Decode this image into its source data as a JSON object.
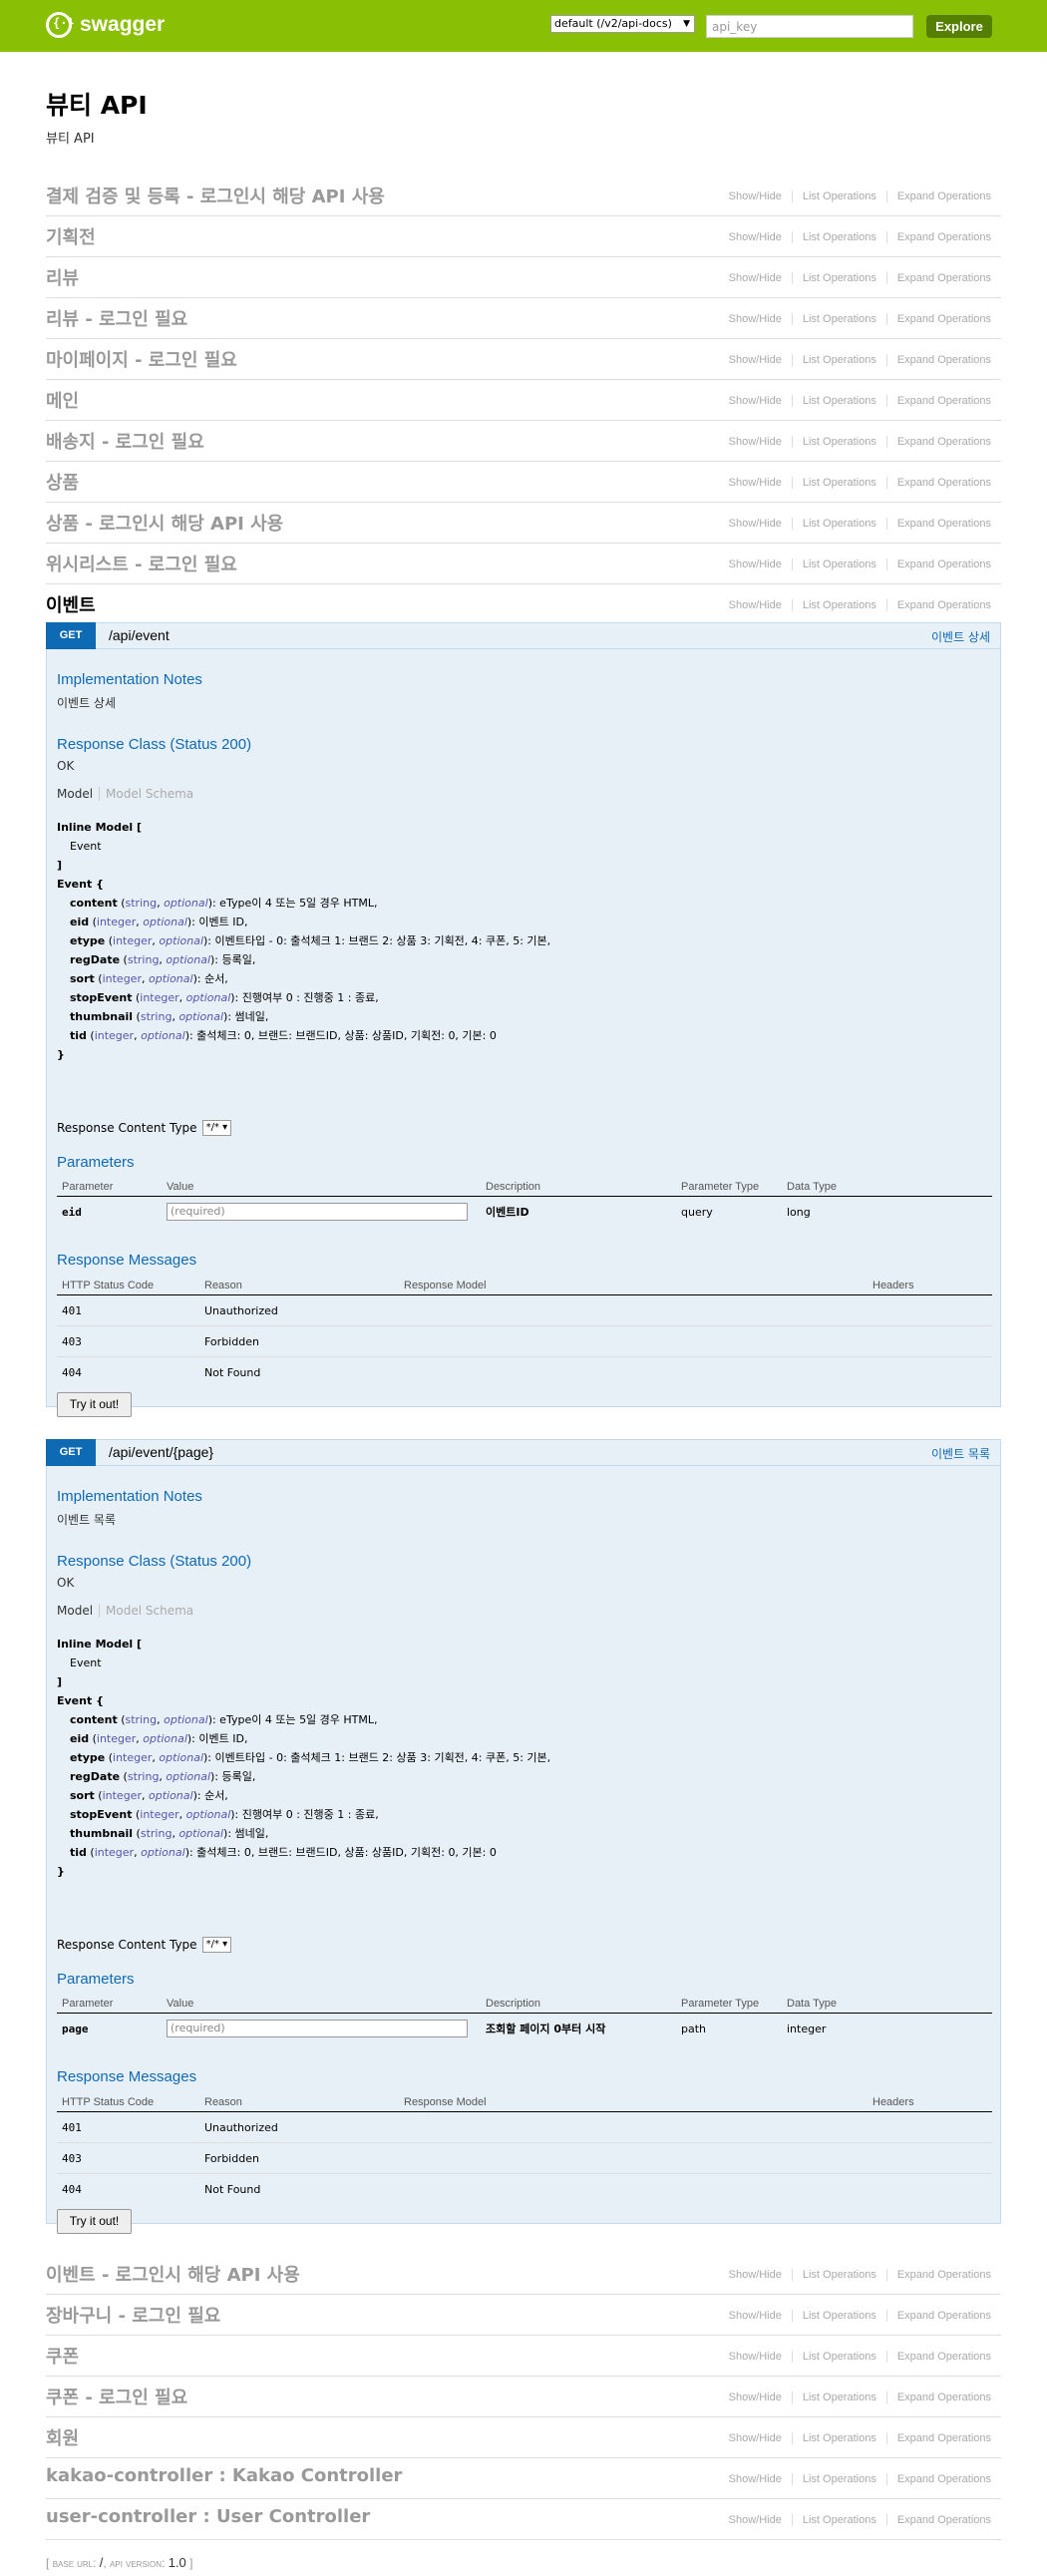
{
  "header": {
    "logo_text": "swagger",
    "logo_icon": "swagger-braces-icon",
    "spec_select": "default (/v2/api-docs)",
    "api_key_placeholder": "api_key",
    "explore_label": "Explore"
  },
  "info": {
    "title": "뷰티 API",
    "description": "뷰티 API"
  },
  "ops_labels": {
    "show_hide": "Show/Hide",
    "list_operations": "List Operations",
    "expand_operations": "Expand Operations"
  },
  "resources_top": [
    "결제 검증 및 등록 - 로그인시 해당 API 사용",
    "기획전",
    "리뷰",
    "리뷰 - 로그인 필요",
    "마이페이지 - 로그인 필요",
    "메인",
    "배송지 - 로그인 필요",
    "상품",
    "상품 - 로그인시 해당 API 사용",
    "위시리스트 - 로그인 필요",
    "이벤트"
  ],
  "resources_bottom": [
    "이벤트 - 로그인시 해당 API 사용",
    "장바구니 - 로그인 필요",
    "쿠폰",
    "쿠폰 - 로그인 필요",
    "회원",
    "kakao-controller : Kakao Controller",
    "user-controller : User Controller"
  ],
  "labels": {
    "implementation_notes": "Implementation Notes",
    "response_class": "Response Class (Status 200)",
    "ok": "OK",
    "model": "Model",
    "model_schema": "Model Schema",
    "inline_model": "Inline Model [",
    "inline_item": "Event",
    "inline_close": "]",
    "event_open": "Event {",
    "event_close": "}",
    "response_content_type": "Response Content Type",
    "content_type_value": "*/*",
    "parameters": "Parameters",
    "response_messages": "Response Messages",
    "try_it_out": "Try it out!",
    "param_headers": [
      "Parameter",
      "Value",
      "Description",
      "Parameter Type",
      "Data Type"
    ],
    "resp_headers": [
      "HTTP Status Code",
      "Reason",
      "Response Model",
      "Headers"
    ],
    "required_placeholder": "(required)"
  },
  "event_props": [
    {
      "name": "content",
      "type": "string",
      "opt": "optional",
      "desc": "): eType이 4 또는 5일 경우 HTML,"
    },
    {
      "name": "eid",
      "type": "integer",
      "opt": "optional",
      "desc": "): 이벤트 ID,"
    },
    {
      "name": "etype",
      "type": "integer",
      "opt": "optional",
      "desc": "): 이벤트타입 - 0: 출석체크 1: 브랜드 2: 상품 3: 기획전, 4: 쿠폰, 5: 기본,"
    },
    {
      "name": "regDate",
      "type": "string",
      "opt": "optional",
      "desc": "): 등록일,"
    },
    {
      "name": "sort",
      "type": "integer",
      "opt": "optional",
      "desc": "): 순서,"
    },
    {
      "name": "stopEvent",
      "type": "integer",
      "opt": "optional",
      "desc": "): 진행여부 0 : 진행중 1 : 종료,"
    },
    {
      "name": "thumbnail",
      "type": "string",
      "opt": "optional",
      "desc": "): 썸네일,"
    },
    {
      "name": "tid",
      "type": "integer",
      "opt": "optional",
      "desc": "): 출석체크: 0, 브랜드: 브랜드ID, 상품: 상품ID, 기획전: 0, 기본: 0"
    }
  ],
  "response_messages": [
    {
      "code": "401",
      "reason": "Unauthorized"
    },
    {
      "code": "403",
      "reason": "Forbidden"
    },
    {
      "code": "404",
      "reason": "Not Found"
    }
  ],
  "operations": [
    {
      "method": "GET",
      "path": "/api/event",
      "summary": "이벤트 상세",
      "notes": "이벤트 상세",
      "param": {
        "name": "eid",
        "description": "이벤트ID",
        "param_type": "query",
        "data_type": "long"
      }
    },
    {
      "method": "GET",
      "path": "/api/event/{page}",
      "summary": "이벤트 목록",
      "notes": "이벤트 목록",
      "param": {
        "name": "page",
        "description": "조회할 페이지 0부터 시작",
        "param_type": "path",
        "data_type": "integer"
      }
    }
  ],
  "footer": {
    "open": "[",
    "base_url_label": "base url",
    "base_url": "/",
    "api_version_label": "api version",
    "api_version": "1.0",
    "close": "]"
  }
}
